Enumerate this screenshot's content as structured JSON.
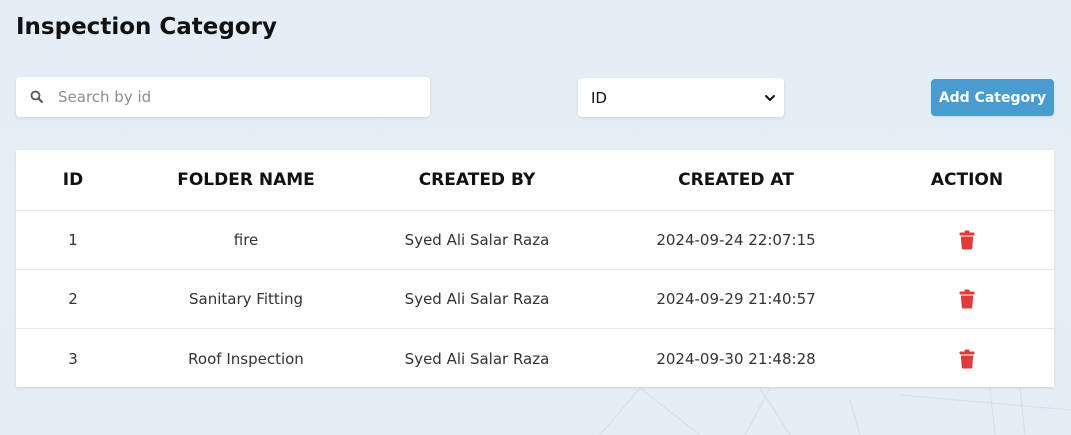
{
  "page": {
    "title": "Inspection Category"
  },
  "search": {
    "placeholder": "Search by id",
    "value": "",
    "icon": "search-icon"
  },
  "filter": {
    "selected": "ID",
    "icon": "chevron-down-icon"
  },
  "toolbar": {
    "add_label": "Add Category",
    "add_color": "#4a9bd0"
  },
  "table": {
    "columns": [
      "ID",
      "FOLDER NAME",
      "CREATED BY",
      "CREATED AT",
      "ACTION"
    ],
    "rows": [
      {
        "id": "1",
        "folder_name": "fire",
        "created_by": "Syed Ali Salar Raza",
        "created_at": "2024-09-24 22:07:15",
        "action_icon": "trash-icon"
      },
      {
        "id": "2",
        "folder_name": "Sanitary Fitting",
        "created_by": "Syed Ali Salar Raza",
        "created_at": "2024-09-29 21:40:57",
        "action_icon": "trash-icon"
      },
      {
        "id": "3",
        "folder_name": "Roof Inspection",
        "created_by": "Syed Ali Salar Raza",
        "created_at": "2024-09-30 21:48:28",
        "action_icon": "trash-icon"
      }
    ],
    "delete_color": "#e03b3b"
  }
}
